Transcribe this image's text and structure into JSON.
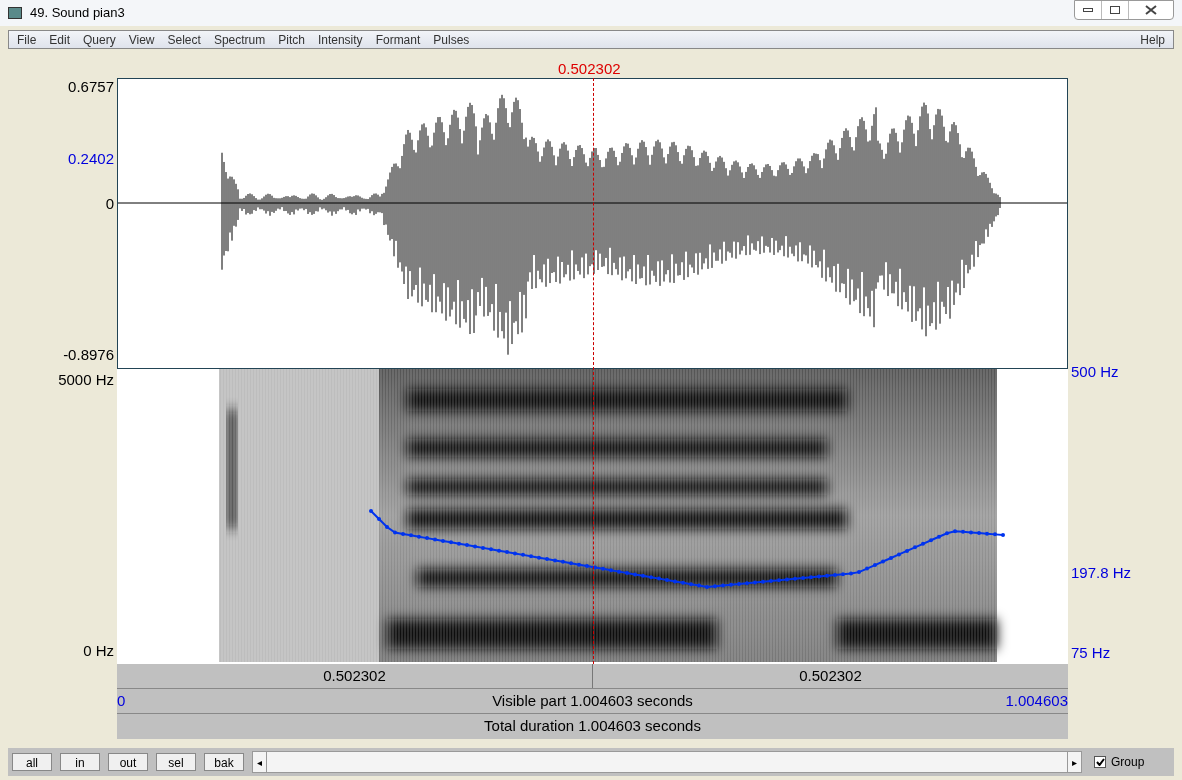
{
  "window": {
    "title": "49. Sound pian3"
  },
  "menu": [
    "File",
    "Edit",
    "Query",
    "View",
    "Select",
    "Spectrum",
    "Pitch",
    "Intensity",
    "Formant",
    "Pulses"
  ],
  "help": "Help",
  "cursor": {
    "label": "0.502302"
  },
  "waveform": {
    "ticks": [
      {
        "label": "0.6757",
        "kind": "max"
      },
      {
        "label": "0.2402",
        "kind": "marked"
      },
      {
        "label": "0",
        "kind": "zero"
      },
      {
        "label": "-0.8976",
        "kind": "min"
      }
    ]
  },
  "spectrogram": {
    "top": "5000 Hz",
    "bottom": "0 Hz",
    "pitch_top": "500 Hz",
    "pitch_mid": "197.8 Hz",
    "pitch_bottom": "75 Hz"
  },
  "bars": {
    "left_part": "0.502302",
    "right_part": "0.502302",
    "visible_start": "0",
    "visible": "Visible part 1.004603 seconds",
    "visible_end": "1.004603",
    "total": "Total duration 1.004603 seconds"
  },
  "buttons": [
    "all",
    "in",
    "out",
    "sel",
    "bak"
  ],
  "scroll_left": "◂",
  "scroll_right": "▸",
  "group": {
    "label": "Group",
    "checked": true
  }
}
